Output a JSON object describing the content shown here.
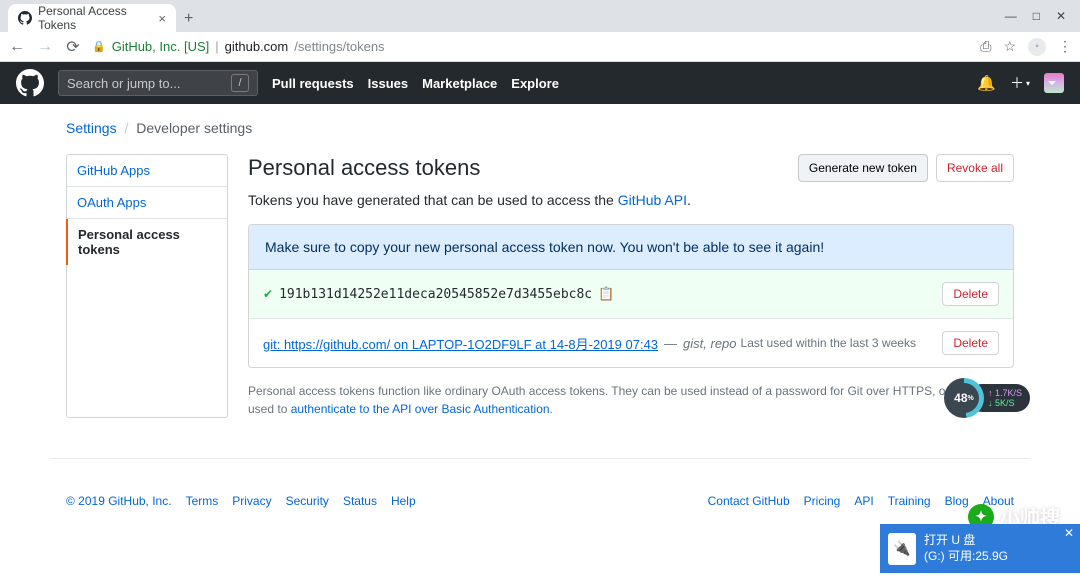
{
  "browser": {
    "tab_title": "Personal Access Tokens",
    "url_secure_label": "GitHub, Inc. [US]",
    "url_host": "github.com",
    "url_path": "/settings/tokens"
  },
  "gh_header": {
    "search_placeholder": "Search or jump to...",
    "slash": "/",
    "nav": [
      "Pull requests",
      "Issues",
      "Marketplace",
      "Explore"
    ]
  },
  "breadcrumb": {
    "root": "Settings",
    "current": "Developer settings"
  },
  "sidebar": {
    "items": [
      {
        "label": "GitHub Apps"
      },
      {
        "label": "OAuth Apps"
      },
      {
        "label": "Personal access tokens"
      }
    ]
  },
  "page": {
    "title": "Personal access tokens",
    "generate_btn": "Generate new token",
    "revoke_btn": "Revoke all",
    "subtext_pre": "Tokens you have generated that can be used to access the ",
    "subtext_link": "GitHub API",
    "flash": "Make sure to copy your new personal access token now. You won't be able to see it again!",
    "tokens": [
      {
        "new": true,
        "value": "191b131d14252e11deca20545852e7d3455ebc8c",
        "delete": "Delete"
      },
      {
        "new": false,
        "desc": "git: https://github.com/ on LAPTOP-1O2DF9LF at 14-8月-2019 07:43",
        "dash": "—",
        "scopes": "gist, repo",
        "last_used": "Last used within the last 3 weeks",
        "delete": "Delete"
      }
    ],
    "note_pre": "Personal access tokens function like ordinary OAuth access tokens. They can be used instead of a password for Git over HTTPS, or can be used to ",
    "note_link": "authenticate to the API over Basic Authentication",
    "note_post": "."
  },
  "footer": {
    "copyright": "© 2019 GitHub, Inc.",
    "left": [
      "Terms",
      "Privacy",
      "Security",
      "Status",
      "Help"
    ],
    "right": [
      "Contact GitHub",
      "Pricing",
      "API",
      "Training",
      "Blog",
      "About"
    ]
  },
  "overlay": {
    "meter_pct": "48",
    "meter_unit": "%",
    "net_up": "1.7K/S",
    "net_dn": "5K/S",
    "toast_line1": "打开 U 盘",
    "toast_line2": "(G:)   可用:25.9G",
    "watermark": "小帅搜"
  }
}
